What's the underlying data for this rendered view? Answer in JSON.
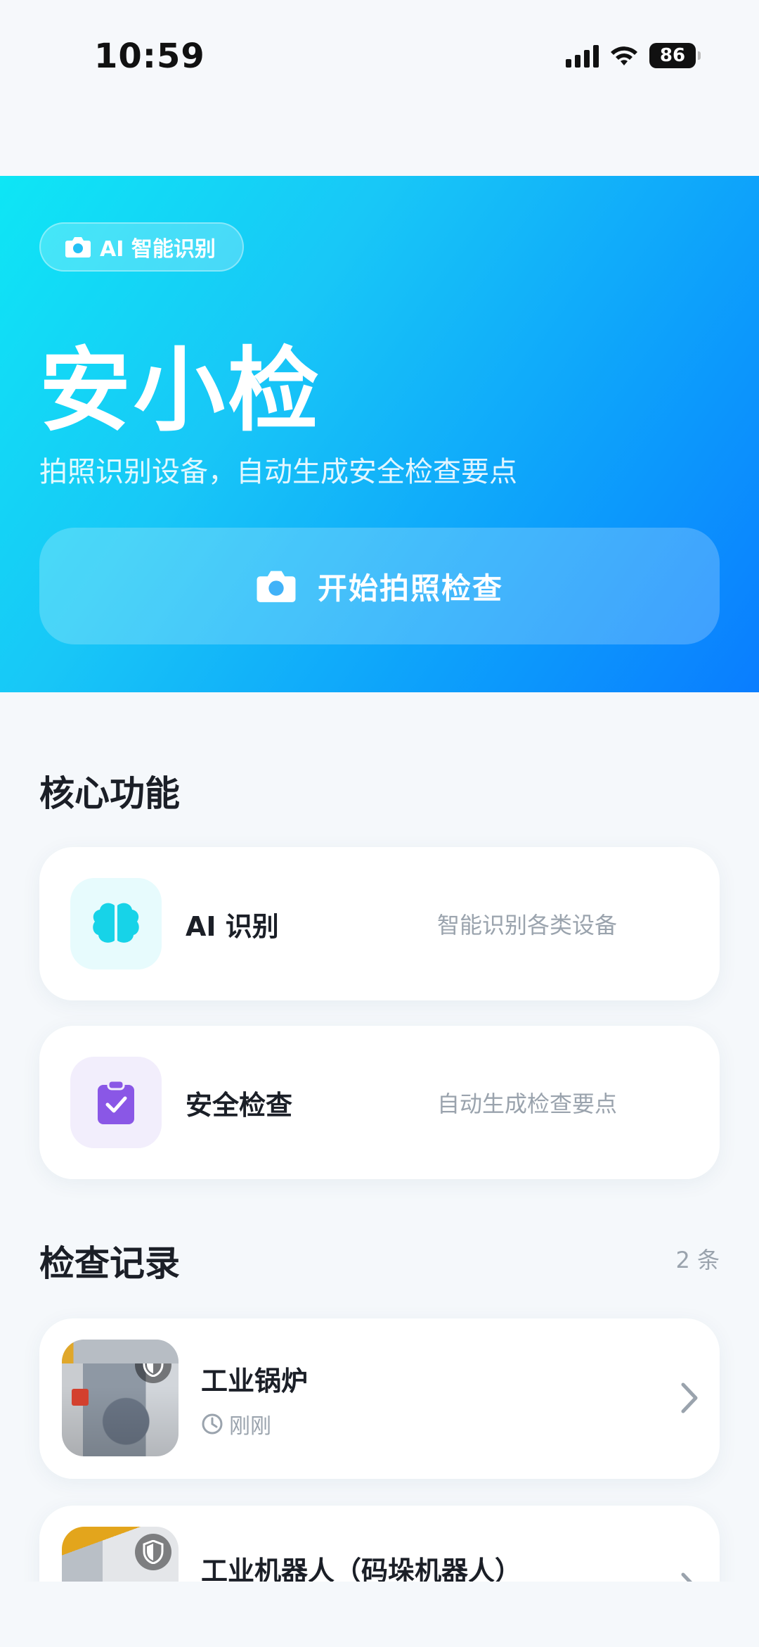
{
  "status_bar": {
    "time": "10:59",
    "battery": "86"
  },
  "hero": {
    "chip_label": "AI 智能识别",
    "title": "安小检",
    "subtitle": "拍照识别设备，自动生成安全检查要点",
    "start_button": "开始拍照检查"
  },
  "features": {
    "section_title": "核心功能",
    "items": [
      {
        "name": "AI 识别",
        "desc": "智能识别各类设备",
        "icon": "brain-icon",
        "icon_color": "#17d3e8",
        "bg": "#e7fbfd"
      },
      {
        "name": "安全检查",
        "desc": "自动生成检查要点",
        "icon": "clipboard-check-icon",
        "icon_color": "#8a57e6",
        "bg": "#f2eefc"
      }
    ]
  },
  "records": {
    "section_title": "检查记录",
    "count": "2 条",
    "items": [
      {
        "name": "工业锅炉",
        "time": "刚刚"
      },
      {
        "name": "工业机器人（码垛机器人）",
        "time": ""
      }
    ]
  },
  "colors": {
    "accent_start": "#0ee6f5",
    "accent_end": "#0a7dff"
  }
}
